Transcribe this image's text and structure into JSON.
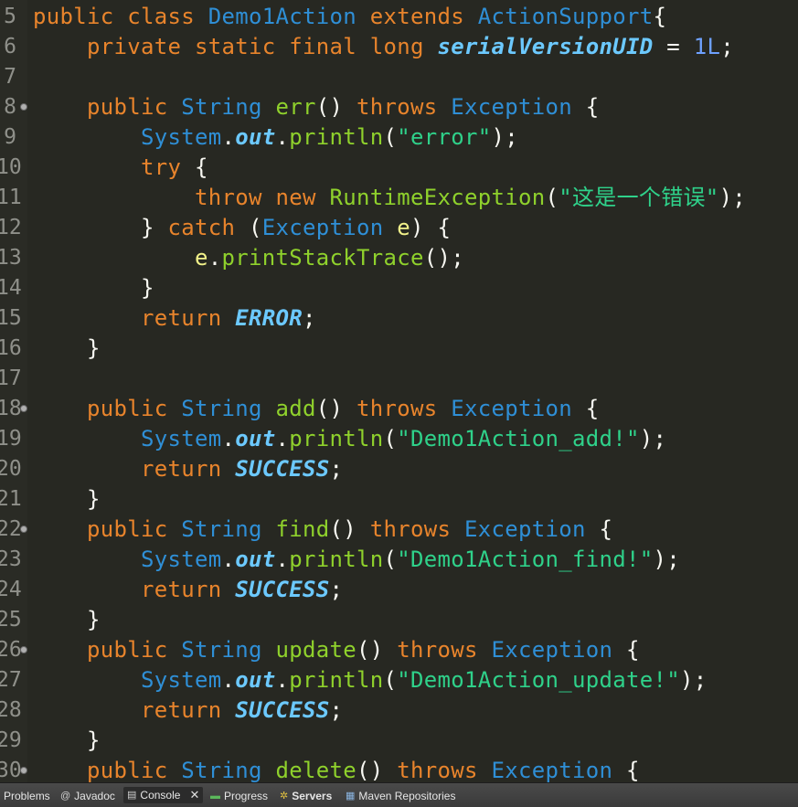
{
  "editor": {
    "lines": [
      {
        "number": "5",
        "fold": false,
        "tokens": [
          [
            "keyword",
            "public "
          ],
          [
            "keyword",
            "class "
          ],
          [
            "type",
            "Demo1Action "
          ],
          [
            "keyword",
            "extends "
          ],
          [
            "type",
            "ActionSupport"
          ],
          [
            "plain",
            "{"
          ]
        ]
      },
      {
        "number": "6",
        "fold": false,
        "tokens": [
          [
            "plain",
            "    "
          ],
          [
            "keyword",
            "private "
          ],
          [
            "keyword",
            "static "
          ],
          [
            "keyword",
            "final "
          ],
          [
            "keyword",
            "long "
          ],
          [
            "field",
            "serialVersionUID"
          ],
          [
            "plain",
            " = "
          ],
          [
            "number",
            "1L"
          ],
          [
            "plain",
            ";"
          ]
        ]
      },
      {
        "number": "7",
        "fold": false,
        "tokens": []
      },
      {
        "number": "8",
        "fold": true,
        "tokens": [
          [
            "plain",
            "    "
          ],
          [
            "keyword",
            "public "
          ],
          [
            "type",
            "String "
          ],
          [
            "method",
            "err"
          ],
          [
            "plain",
            "() "
          ],
          [
            "keyword",
            "throws "
          ],
          [
            "type",
            "Exception "
          ],
          [
            "plain",
            "{"
          ]
        ]
      },
      {
        "number": "9",
        "fold": false,
        "tokens": [
          [
            "plain",
            "        "
          ],
          [
            "type",
            "System"
          ],
          [
            "plain",
            "."
          ],
          [
            "field",
            "out"
          ],
          [
            "plain",
            "."
          ],
          [
            "method",
            "println"
          ],
          [
            "plain",
            "("
          ],
          [
            "string",
            "\"error\""
          ],
          [
            "plain",
            ");"
          ]
        ]
      },
      {
        "number": "10",
        "fold": false,
        "tokens": [
          [
            "plain",
            "        "
          ],
          [
            "keyword",
            "try "
          ],
          [
            "plain",
            "{"
          ]
        ]
      },
      {
        "number": "11",
        "fold": false,
        "tokens": [
          [
            "plain",
            "            "
          ],
          [
            "keyword",
            "throw "
          ],
          [
            "keyword",
            "new "
          ],
          [
            "method",
            "RuntimeException"
          ],
          [
            "plain",
            "("
          ],
          [
            "string",
            "\"这是一个错误\""
          ],
          [
            "plain",
            ");"
          ]
        ]
      },
      {
        "number": "12",
        "fold": false,
        "tokens": [
          [
            "plain",
            "        } "
          ],
          [
            "keyword",
            "catch "
          ],
          [
            "plain",
            "("
          ],
          [
            "type",
            "Exception "
          ],
          [
            "var",
            "e"
          ],
          [
            "plain",
            ") {"
          ]
        ]
      },
      {
        "number": "13",
        "fold": false,
        "tokens": [
          [
            "plain",
            "            "
          ],
          [
            "var",
            "e"
          ],
          [
            "plain",
            "."
          ],
          [
            "method",
            "printStackTrace"
          ],
          [
            "plain",
            "();"
          ]
        ]
      },
      {
        "number": "14",
        "fold": false,
        "tokens": [
          [
            "plain",
            "        }"
          ]
        ]
      },
      {
        "number": "15",
        "fold": false,
        "tokens": [
          [
            "plain",
            "        "
          ],
          [
            "keyword",
            "return "
          ],
          [
            "const",
            "ERROR"
          ],
          [
            "plain",
            ";"
          ]
        ]
      },
      {
        "number": "16",
        "fold": false,
        "tokens": [
          [
            "plain",
            "    }"
          ]
        ]
      },
      {
        "number": "17",
        "fold": false,
        "tokens": []
      },
      {
        "number": "18",
        "fold": true,
        "tokens": [
          [
            "plain",
            "    "
          ],
          [
            "keyword",
            "public "
          ],
          [
            "type",
            "String "
          ],
          [
            "method",
            "add"
          ],
          [
            "plain",
            "() "
          ],
          [
            "keyword",
            "throws "
          ],
          [
            "type",
            "Exception "
          ],
          [
            "plain",
            "{"
          ]
        ]
      },
      {
        "number": "19",
        "fold": false,
        "tokens": [
          [
            "plain",
            "        "
          ],
          [
            "type",
            "System"
          ],
          [
            "plain",
            "."
          ],
          [
            "field",
            "out"
          ],
          [
            "plain",
            "."
          ],
          [
            "method",
            "println"
          ],
          [
            "plain",
            "("
          ],
          [
            "string",
            "\"Demo1Action_add!\""
          ],
          [
            "plain",
            ");"
          ]
        ]
      },
      {
        "number": "20",
        "fold": false,
        "tokens": [
          [
            "plain",
            "        "
          ],
          [
            "keyword",
            "return "
          ],
          [
            "const",
            "SUCCESS"
          ],
          [
            "plain",
            ";"
          ]
        ]
      },
      {
        "number": "21",
        "fold": false,
        "tokens": [
          [
            "plain",
            "    }"
          ]
        ]
      },
      {
        "number": "22",
        "fold": true,
        "tokens": [
          [
            "plain",
            "    "
          ],
          [
            "keyword",
            "public "
          ],
          [
            "type",
            "String "
          ],
          [
            "method",
            "find"
          ],
          [
            "plain",
            "() "
          ],
          [
            "keyword",
            "throws "
          ],
          [
            "type",
            "Exception "
          ],
          [
            "plain",
            "{"
          ]
        ]
      },
      {
        "number": "23",
        "fold": false,
        "tokens": [
          [
            "plain",
            "        "
          ],
          [
            "type",
            "System"
          ],
          [
            "plain",
            "."
          ],
          [
            "field",
            "out"
          ],
          [
            "plain",
            "."
          ],
          [
            "method",
            "println"
          ],
          [
            "plain",
            "("
          ],
          [
            "string",
            "\"Demo1Action_find!\""
          ],
          [
            "plain",
            ");"
          ]
        ]
      },
      {
        "number": "24",
        "fold": false,
        "tokens": [
          [
            "plain",
            "        "
          ],
          [
            "keyword",
            "return "
          ],
          [
            "const",
            "SUCCESS"
          ],
          [
            "plain",
            ";"
          ]
        ]
      },
      {
        "number": "25",
        "fold": false,
        "tokens": [
          [
            "plain",
            "    }"
          ]
        ]
      },
      {
        "number": "26",
        "fold": true,
        "tokens": [
          [
            "plain",
            "    "
          ],
          [
            "keyword",
            "public "
          ],
          [
            "type",
            "String "
          ],
          [
            "method",
            "update"
          ],
          [
            "plain",
            "() "
          ],
          [
            "keyword",
            "throws "
          ],
          [
            "type",
            "Exception "
          ],
          [
            "plain",
            "{"
          ]
        ]
      },
      {
        "number": "27",
        "fold": false,
        "tokens": [
          [
            "plain",
            "        "
          ],
          [
            "type",
            "System"
          ],
          [
            "plain",
            "."
          ],
          [
            "field",
            "out"
          ],
          [
            "plain",
            "."
          ],
          [
            "method",
            "println"
          ],
          [
            "plain",
            "("
          ],
          [
            "string",
            "\"Demo1Action_update!\""
          ],
          [
            "plain",
            ");"
          ]
        ]
      },
      {
        "number": "28",
        "fold": false,
        "tokens": [
          [
            "plain",
            "        "
          ],
          [
            "keyword",
            "return "
          ],
          [
            "const",
            "SUCCESS"
          ],
          [
            "plain",
            ";"
          ]
        ]
      },
      {
        "number": "29",
        "fold": false,
        "tokens": [
          [
            "plain",
            "    }"
          ]
        ]
      },
      {
        "number": "30",
        "fold": true,
        "tokens": [
          [
            "plain",
            "    "
          ],
          [
            "keyword",
            "public "
          ],
          [
            "type",
            "String "
          ],
          [
            "method",
            "delete"
          ],
          [
            "plain",
            "() "
          ],
          [
            "keyword",
            "throws "
          ],
          [
            "type",
            "Exception "
          ],
          [
            "plain",
            "{"
          ]
        ]
      }
    ]
  },
  "bottom_panel": {
    "tabs": [
      {
        "label": "Problems",
        "icon": "problems-icon",
        "glyph": ""
      },
      {
        "label": "Javadoc",
        "icon": "javadoc-icon",
        "glyph": "@"
      },
      {
        "label": "Console",
        "icon": "console-icon",
        "glyph": "▤",
        "active": true,
        "close": "✕"
      },
      {
        "label": "Progress",
        "icon": "progress-icon",
        "glyph": "▬"
      },
      {
        "label": "Servers",
        "icon": "servers-icon",
        "glyph": "✲"
      },
      {
        "label": "Maven Repositories",
        "icon": "maven-repositories-icon",
        "glyph": "▦"
      }
    ]
  },
  "colors": {
    "background": "#272822",
    "keyword": "#e8842c",
    "type": "#2f8fd6",
    "method": "#8fd12c",
    "string": "#2fd18a",
    "constant": "#6cc9ff"
  }
}
